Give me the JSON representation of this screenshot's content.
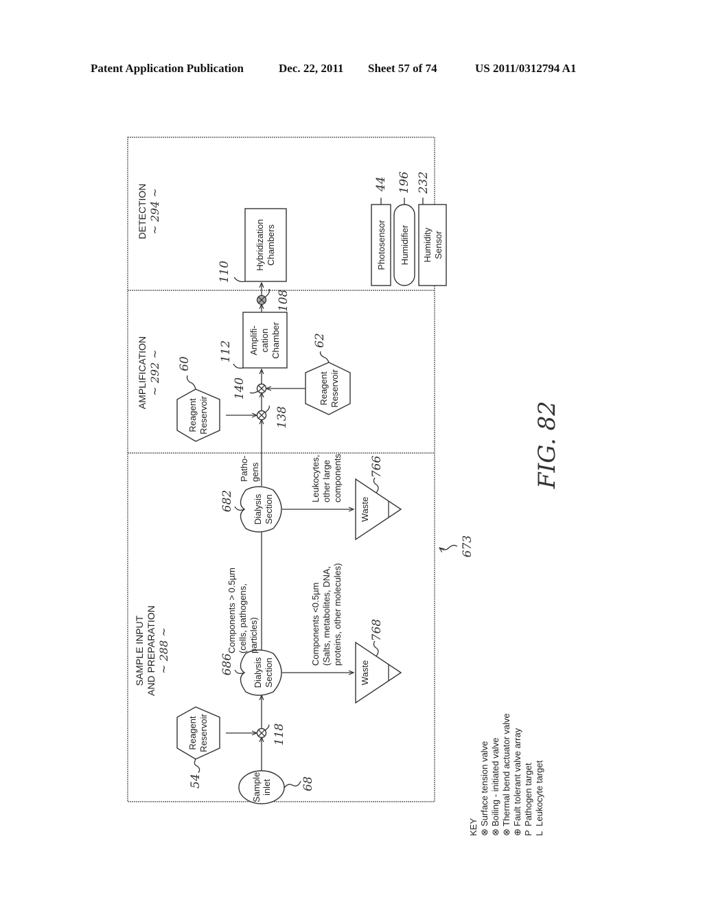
{
  "header": {
    "publication": "Patent Application Publication",
    "date": "Dec. 22, 2011",
    "sheet": "Sheet 57 of 74",
    "number": "US 2011/0312794 A1"
  },
  "sections": {
    "detection": {
      "title": "DETECTION",
      "ref": "~ 294 ~"
    },
    "amplification": {
      "title": "AMPLIFICATION",
      "ref": "~ 292 ~"
    },
    "sample": {
      "title1": "SAMPLE INPUT",
      "title2": "AND PREPARATION",
      "ref": "~ 288 ~"
    }
  },
  "nodes": {
    "sample_inlet": {
      "l1": "Sample",
      "l2": "inlet",
      "ref": "68"
    },
    "reagent_54": {
      "l1": "Reagent",
      "l2": "Reservoir",
      "ref": "54"
    },
    "valve_118": {
      "ref": "118"
    },
    "dialysis_686": {
      "l1": "Dialysis",
      "l2": "Section",
      "ref": "686"
    },
    "dialysis_682": {
      "l1": "Dialysis",
      "l2": "Section",
      "ref": "682"
    },
    "waste_768": {
      "label": "Waste",
      "ref": "768"
    },
    "waste_766": {
      "label": "Waste",
      "ref": "766"
    },
    "reagent_60": {
      "l1": "Reagent",
      "l2": "Reservoir",
      "ref": "60"
    },
    "reagent_62": {
      "l1": "Reagent",
      "l2": "Reservoir",
      "ref": "62"
    },
    "valve_138": {
      "ref": "138"
    },
    "valve_140": {
      "ref": "140"
    },
    "amp_chamber": {
      "l1": "Amplifi-",
      "l2": "cation",
      "l3": "Chamber",
      "ref": "112"
    },
    "valve_108": {
      "ref": "108"
    },
    "hyb_chamber": {
      "l1": "Hybridization",
      "l2": "Chambers",
      "ref": "110"
    },
    "photosensor": {
      "label": "Photosensor",
      "ref": "44"
    },
    "humidifier": {
      "label": "Humidifier",
      "ref": "196"
    },
    "humidity_sensor": {
      "l1": "Humidity",
      "l2": "Sensor",
      "ref": "232"
    }
  },
  "flow_labels": {
    "large": {
      "l1": "Components > 0.5µm",
      "l2": "(cells, pathogens,",
      "l3": "particles)"
    },
    "small": {
      "l1": "Components <0.5µm",
      "l2": "(Salts, metabolites, DNA,",
      "l3": "proteins, other molecules)"
    },
    "leuko": {
      "l1": "Leukocytes,",
      "l2": "other large",
      "l3": "components"
    },
    "pathogens": {
      "l1": "Patho-",
      "l2": "gens"
    }
  },
  "key": {
    "title": "KEY",
    "items": [
      {
        "symbol": "⊗",
        "label": "Surface tension valve"
      },
      {
        "symbol": "⊗",
        "label": "Boiling - initiated valve"
      },
      {
        "symbol": "⊗",
        "label": "Thermal bend actuator valve"
      },
      {
        "symbol": "⊕",
        "label": "Fault tolerant valve array"
      },
      {
        "symbol": "P",
        "label": "Pathogen target"
      },
      {
        "symbol": "L",
        "label": "Leukocyte target"
      }
    ]
  },
  "figure": {
    "label": "FIG. 82",
    "ref": "673"
  }
}
